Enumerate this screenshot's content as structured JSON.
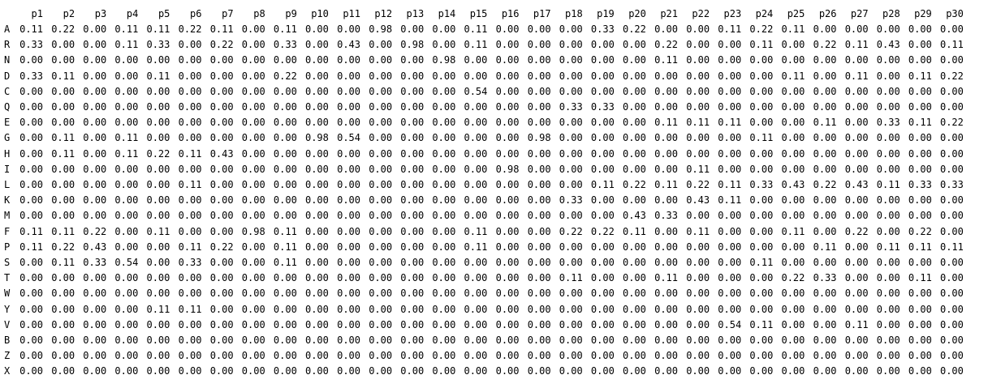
{
  "columns": [
    "p1",
    "p2",
    "p3",
    "p4",
    "p5",
    "p6",
    "p7",
    "p8",
    "p9",
    "p10",
    "p11",
    "p12",
    "p13",
    "p14",
    "p15",
    "p16",
    "p17",
    "p18",
    "p19",
    "p20",
    "p21",
    "p22",
    "p23",
    "p24",
    "p25",
    "p26",
    "p27",
    "p28",
    "p29",
    "p30"
  ],
  "rows": [
    {
      "label": "A",
      "values": [
        "0.11",
        "0.22",
        "0.00",
        "0.11",
        "0.11",
        "0.22",
        "0.11",
        "0.00",
        "0.11",
        "0.00",
        "0.00",
        "0.98",
        "0.00",
        "0.00",
        "0.11",
        "0.00",
        "0.00",
        "0.00",
        "0.33",
        "0.22",
        "0.00",
        "0.00",
        "0.11",
        "0.22",
        "0.11",
        "0.00",
        "0.00",
        "0.00",
        "0.00",
        "0.00"
      ]
    },
    {
      "label": "R",
      "values": [
        "0.33",
        "0.00",
        "0.00",
        "0.11",
        "0.33",
        "0.00",
        "0.22",
        "0.00",
        "0.33",
        "0.00",
        "0.43",
        "0.00",
        "0.98",
        "0.00",
        "0.11",
        "0.00",
        "0.00",
        "0.00",
        "0.00",
        "0.00",
        "0.22",
        "0.00",
        "0.00",
        "0.11",
        "0.00",
        "0.22",
        "0.11",
        "0.43",
        "0.00",
        "0.11"
      ]
    },
    {
      "label": "N",
      "values": [
        "0.00",
        "0.00",
        "0.00",
        "0.00",
        "0.00",
        "0.00",
        "0.00",
        "0.00",
        "0.00",
        "0.00",
        "0.00",
        "0.00",
        "0.00",
        "0.98",
        "0.00",
        "0.00",
        "0.00",
        "0.00",
        "0.00",
        "0.00",
        "0.11",
        "0.00",
        "0.00",
        "0.00",
        "0.00",
        "0.00",
        "0.00",
        "0.00",
        "0.00",
        "0.00"
      ]
    },
    {
      "label": "D",
      "values": [
        "0.33",
        "0.11",
        "0.00",
        "0.00",
        "0.11",
        "0.00",
        "0.00",
        "0.00",
        "0.22",
        "0.00",
        "0.00",
        "0.00",
        "0.00",
        "0.00",
        "0.00",
        "0.00",
        "0.00",
        "0.00",
        "0.00",
        "0.00",
        "0.00",
        "0.00",
        "0.00",
        "0.00",
        "0.11",
        "0.00",
        "0.11",
        "0.00",
        "0.11",
        "0.22"
      ]
    },
    {
      "label": "C",
      "values": [
        "0.00",
        "0.00",
        "0.00",
        "0.00",
        "0.00",
        "0.00",
        "0.00",
        "0.00",
        "0.00",
        "0.00",
        "0.00",
        "0.00",
        "0.00",
        "0.00",
        "0.54",
        "0.00",
        "0.00",
        "0.00",
        "0.00",
        "0.00",
        "0.00",
        "0.00",
        "0.00",
        "0.00",
        "0.00",
        "0.00",
        "0.00",
        "0.00",
        "0.00",
        "0.00"
      ]
    },
    {
      "label": "Q",
      "values": [
        "0.00",
        "0.00",
        "0.00",
        "0.00",
        "0.00",
        "0.00",
        "0.00",
        "0.00",
        "0.00",
        "0.00",
        "0.00",
        "0.00",
        "0.00",
        "0.00",
        "0.00",
        "0.00",
        "0.00",
        "0.33",
        "0.33",
        "0.00",
        "0.00",
        "0.00",
        "0.00",
        "0.00",
        "0.00",
        "0.00",
        "0.00",
        "0.00",
        "0.00",
        "0.00"
      ]
    },
    {
      "label": "E",
      "values": [
        "0.00",
        "0.00",
        "0.00",
        "0.00",
        "0.00",
        "0.00",
        "0.00",
        "0.00",
        "0.00",
        "0.00",
        "0.00",
        "0.00",
        "0.00",
        "0.00",
        "0.00",
        "0.00",
        "0.00",
        "0.00",
        "0.00",
        "0.00",
        "0.11",
        "0.11",
        "0.11",
        "0.00",
        "0.00",
        "0.11",
        "0.00",
        "0.33",
        "0.11",
        "0.22"
      ]
    },
    {
      "label": "G",
      "values": [
        "0.00",
        "0.11",
        "0.00",
        "0.11",
        "0.00",
        "0.00",
        "0.00",
        "0.00",
        "0.00",
        "0.98",
        "0.54",
        "0.00",
        "0.00",
        "0.00",
        "0.00",
        "0.00",
        "0.98",
        "0.00",
        "0.00",
        "0.00",
        "0.00",
        "0.00",
        "0.00",
        "0.11",
        "0.00",
        "0.00",
        "0.00",
        "0.00",
        "0.00",
        "0.00"
      ]
    },
    {
      "label": "H",
      "values": [
        "0.00",
        "0.11",
        "0.00",
        "0.11",
        "0.22",
        "0.11",
        "0.43",
        "0.00",
        "0.00",
        "0.00",
        "0.00",
        "0.00",
        "0.00",
        "0.00",
        "0.00",
        "0.00",
        "0.00",
        "0.00",
        "0.00",
        "0.00",
        "0.00",
        "0.00",
        "0.00",
        "0.00",
        "0.00",
        "0.00",
        "0.00",
        "0.00",
        "0.00",
        "0.00"
      ]
    },
    {
      "label": "I",
      "values": [
        "0.00",
        "0.00",
        "0.00",
        "0.00",
        "0.00",
        "0.00",
        "0.00",
        "0.00",
        "0.00",
        "0.00",
        "0.00",
        "0.00",
        "0.00",
        "0.00",
        "0.00",
        "0.98",
        "0.00",
        "0.00",
        "0.00",
        "0.00",
        "0.00",
        "0.11",
        "0.00",
        "0.00",
        "0.00",
        "0.00",
        "0.00",
        "0.00",
        "0.00",
        "0.00"
      ]
    },
    {
      "label": "L",
      "values": [
        "0.00",
        "0.00",
        "0.00",
        "0.00",
        "0.00",
        "0.11",
        "0.00",
        "0.00",
        "0.00",
        "0.00",
        "0.00",
        "0.00",
        "0.00",
        "0.00",
        "0.00",
        "0.00",
        "0.00",
        "0.00",
        "0.11",
        "0.22",
        "0.11",
        "0.22",
        "0.11",
        "0.33",
        "0.43",
        "0.22",
        "0.43",
        "0.11",
        "0.33",
        "0.33"
      ]
    },
    {
      "label": "K",
      "values": [
        "0.00",
        "0.00",
        "0.00",
        "0.00",
        "0.00",
        "0.00",
        "0.00",
        "0.00",
        "0.00",
        "0.00",
        "0.00",
        "0.00",
        "0.00",
        "0.00",
        "0.00",
        "0.00",
        "0.00",
        "0.33",
        "0.00",
        "0.00",
        "0.00",
        "0.43",
        "0.11",
        "0.00",
        "0.00",
        "0.00",
        "0.00",
        "0.00",
        "0.00",
        "0.00"
      ]
    },
    {
      "label": "M",
      "values": [
        "0.00",
        "0.00",
        "0.00",
        "0.00",
        "0.00",
        "0.00",
        "0.00",
        "0.00",
        "0.00",
        "0.00",
        "0.00",
        "0.00",
        "0.00",
        "0.00",
        "0.00",
        "0.00",
        "0.00",
        "0.00",
        "0.00",
        "0.43",
        "0.33",
        "0.00",
        "0.00",
        "0.00",
        "0.00",
        "0.00",
        "0.00",
        "0.00",
        "0.00",
        "0.00"
      ]
    },
    {
      "label": "F",
      "values": [
        "0.11",
        "0.11",
        "0.22",
        "0.00",
        "0.11",
        "0.00",
        "0.00",
        "0.98",
        "0.11",
        "0.00",
        "0.00",
        "0.00",
        "0.00",
        "0.00",
        "0.11",
        "0.00",
        "0.00",
        "0.22",
        "0.22",
        "0.11",
        "0.00",
        "0.11",
        "0.00",
        "0.00",
        "0.11",
        "0.00",
        "0.22",
        "0.00",
        "0.22",
        "0.00"
      ]
    },
    {
      "label": "P",
      "values": [
        "0.11",
        "0.22",
        "0.43",
        "0.00",
        "0.00",
        "0.11",
        "0.22",
        "0.00",
        "0.11",
        "0.00",
        "0.00",
        "0.00",
        "0.00",
        "0.00",
        "0.11",
        "0.00",
        "0.00",
        "0.00",
        "0.00",
        "0.00",
        "0.00",
        "0.00",
        "0.00",
        "0.00",
        "0.00",
        "0.11",
        "0.00",
        "0.11",
        "0.11",
        "0.11"
      ]
    },
    {
      "label": "S",
      "values": [
        "0.00",
        "0.11",
        "0.33",
        "0.54",
        "0.00",
        "0.33",
        "0.00",
        "0.00",
        "0.11",
        "0.00",
        "0.00",
        "0.00",
        "0.00",
        "0.00",
        "0.00",
        "0.00",
        "0.00",
        "0.00",
        "0.00",
        "0.00",
        "0.00",
        "0.00",
        "0.00",
        "0.11",
        "0.00",
        "0.00",
        "0.00",
        "0.00",
        "0.00",
        "0.00"
      ]
    },
    {
      "label": "T",
      "values": [
        "0.00",
        "0.00",
        "0.00",
        "0.00",
        "0.00",
        "0.00",
        "0.00",
        "0.00",
        "0.00",
        "0.00",
        "0.00",
        "0.00",
        "0.00",
        "0.00",
        "0.00",
        "0.00",
        "0.00",
        "0.11",
        "0.00",
        "0.00",
        "0.11",
        "0.00",
        "0.00",
        "0.00",
        "0.22",
        "0.33",
        "0.00",
        "0.00",
        "0.11",
        "0.00"
      ]
    },
    {
      "label": "W",
      "values": [
        "0.00",
        "0.00",
        "0.00",
        "0.00",
        "0.00",
        "0.00",
        "0.00",
        "0.00",
        "0.00",
        "0.00",
        "0.00",
        "0.00",
        "0.00",
        "0.00",
        "0.00",
        "0.00",
        "0.00",
        "0.00",
        "0.00",
        "0.00",
        "0.00",
        "0.00",
        "0.00",
        "0.00",
        "0.00",
        "0.00",
        "0.00",
        "0.00",
        "0.00",
        "0.00"
      ]
    },
    {
      "label": "Y",
      "values": [
        "0.00",
        "0.00",
        "0.00",
        "0.00",
        "0.11",
        "0.11",
        "0.00",
        "0.00",
        "0.00",
        "0.00",
        "0.00",
        "0.00",
        "0.00",
        "0.00",
        "0.00",
        "0.00",
        "0.00",
        "0.00",
        "0.00",
        "0.00",
        "0.00",
        "0.00",
        "0.00",
        "0.00",
        "0.00",
        "0.00",
        "0.00",
        "0.00",
        "0.00",
        "0.00"
      ]
    },
    {
      "label": "V",
      "values": [
        "0.00",
        "0.00",
        "0.00",
        "0.00",
        "0.00",
        "0.00",
        "0.00",
        "0.00",
        "0.00",
        "0.00",
        "0.00",
        "0.00",
        "0.00",
        "0.00",
        "0.00",
        "0.00",
        "0.00",
        "0.00",
        "0.00",
        "0.00",
        "0.00",
        "0.00",
        "0.54",
        "0.11",
        "0.00",
        "0.00",
        "0.11",
        "0.00",
        "0.00",
        "0.00"
      ]
    },
    {
      "label": "B",
      "values": [
        "0.00",
        "0.00",
        "0.00",
        "0.00",
        "0.00",
        "0.00",
        "0.00",
        "0.00",
        "0.00",
        "0.00",
        "0.00",
        "0.00",
        "0.00",
        "0.00",
        "0.00",
        "0.00",
        "0.00",
        "0.00",
        "0.00",
        "0.00",
        "0.00",
        "0.00",
        "0.00",
        "0.00",
        "0.00",
        "0.00",
        "0.00",
        "0.00",
        "0.00",
        "0.00"
      ]
    },
    {
      "label": "Z",
      "values": [
        "0.00",
        "0.00",
        "0.00",
        "0.00",
        "0.00",
        "0.00",
        "0.00",
        "0.00",
        "0.00",
        "0.00",
        "0.00",
        "0.00",
        "0.00",
        "0.00",
        "0.00",
        "0.00",
        "0.00",
        "0.00",
        "0.00",
        "0.00",
        "0.00",
        "0.00",
        "0.00",
        "0.00",
        "0.00",
        "0.00",
        "0.00",
        "0.00",
        "0.00",
        "0.00"
      ]
    },
    {
      "label": "X",
      "values": [
        "0.00",
        "0.00",
        "0.00",
        "0.00",
        "0.00",
        "0.00",
        "0.00",
        "0.00",
        "0.00",
        "0.00",
        "0.00",
        "0.00",
        "0.00",
        "0.00",
        "0.00",
        "0.00",
        "0.00",
        "0.00",
        "0.00",
        "0.00",
        "0.00",
        "0.00",
        "0.00",
        "0.00",
        "0.00",
        "0.00",
        "0.00",
        "0.00",
        "0.00",
        "0.00"
      ]
    }
  ]
}
